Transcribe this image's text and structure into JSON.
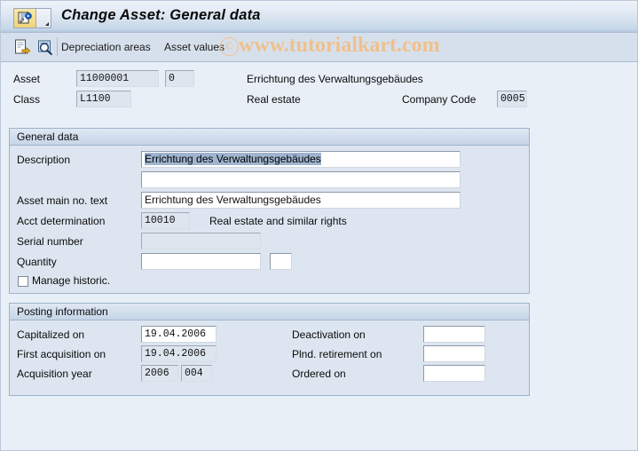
{
  "window": {
    "title": "Change Asset: General data",
    "sys_menu_icon": "sap-asset-icon",
    "caret_icon": "chevron-down-icon"
  },
  "toolbar": {
    "icon1": "document-export-icon",
    "icon2": "display-magnifier-icon",
    "buttons": [
      {
        "label": "Depreciation areas"
      },
      {
        "label": "Asset values"
      }
    ]
  },
  "watermark": {
    "text": "www.tutorialkart.com",
    "copyright": "©",
    "color": "#f0c08c"
  },
  "header": {
    "asset_label": "Asset",
    "asset_number": "11000001",
    "asset_subnumber": "0",
    "asset_description": "Errichtung des Verwaltungsgebäudes",
    "class_label": "Class",
    "class_value": "L1100",
    "class_description": "Real estate",
    "company_code_label": "Company Code",
    "company_code_value": "0005"
  },
  "general_data": {
    "title": "General data",
    "description_label": "Description",
    "description_value": "Errichtung des Verwaltungsgebäudes",
    "description_line2_value": "",
    "asset_main_no_text_label": "Asset main no. text",
    "asset_main_no_text_value": "Errichtung des Verwaltungsgebäudes",
    "acct_determination_label": "Acct determination",
    "acct_determination_value": "10010",
    "acct_determination_text": "Real estate and similar rights",
    "serial_number_label": "Serial number",
    "serial_number_value": "",
    "quantity_label": "Quantity",
    "quantity_value": "",
    "quantity_unit_value": "",
    "manage_historic_label": "Manage historic.",
    "manage_historic_checked": false
  },
  "posting_information": {
    "title": "Posting information",
    "capitalized_on_label": "Capitalized on",
    "capitalized_on_value": "19.04.2006",
    "first_acquisition_on_label": "First acquisition on",
    "first_acquisition_on_value": "19.04.2006",
    "acquisition_year_label": "Acquisition year",
    "acquisition_year_value": "2006",
    "acquisition_period_value": "004",
    "deactivation_on_label": "Deactivation on",
    "deactivation_on_value": "",
    "plnd_retirement_on_label": "Plnd. retirement on",
    "plnd_retirement_on_value": "",
    "ordered_on_label": "Ordered on",
    "ordered_on_value": ""
  },
  "colors": {
    "background": "#e9eff7",
    "group_bg": "#dde6f0",
    "titlebar": "#c5d6e8",
    "toolbar": "#d6e0ec",
    "selection": "#9fb4cf"
  }
}
